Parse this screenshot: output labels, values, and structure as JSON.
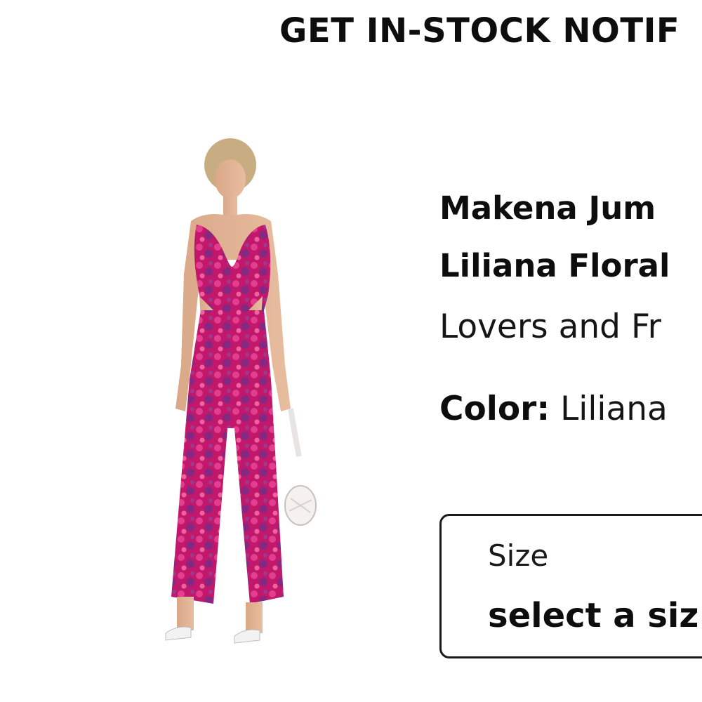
{
  "modal": {
    "title": "GET IN-STOCK NOTIF"
  },
  "product": {
    "name_line1": "Makena Jum",
    "name_line2": "Liliana Floral",
    "brand": "Lovers and Fr",
    "color_label": "Color:",
    "color_value": " Liliana",
    "image_icon": "product-photo-jumpsuit",
    "print_colors": {
      "primary": "#c2186b",
      "secondary": "#e23d8f",
      "accent": "#7a2a86"
    }
  },
  "size_select": {
    "label": "Size",
    "value": "select a siz"
  }
}
